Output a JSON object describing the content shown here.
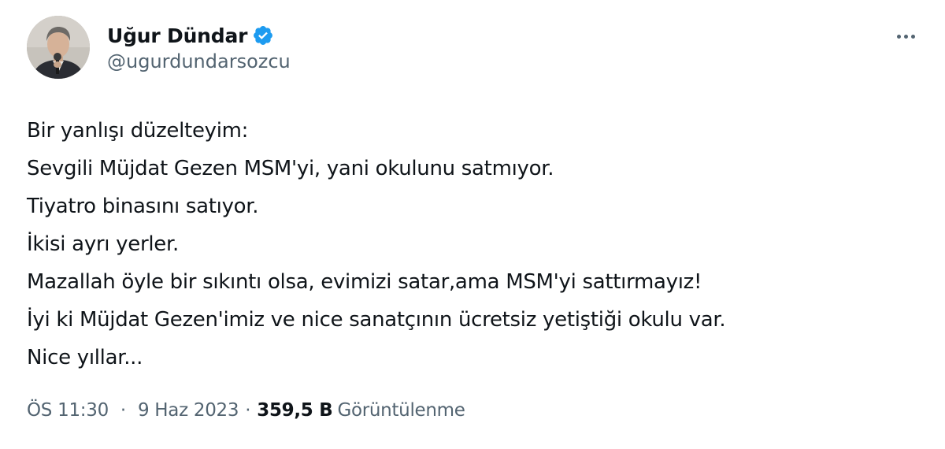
{
  "author": {
    "display_name": "Uğur Dündar",
    "handle": "@ugurdundarsozcu",
    "verified_color": "#1d9bf0"
  },
  "tweet": {
    "lines": [
      "Bir yanlışı düzelteyim:",
      "Sevgili Müjdat Gezen MSM'yi, yani okulunu satmıyor.",
      "Tiyatro binasını satıyor.",
      "İkisi ayrı yerler.",
      "Mazallah öyle bir sıkıntı olsa, evimizi satar,ama MSM'yi sattırmayız!",
      "İyi ki Müjdat Gezen'imiz ve nice sanatçının ücretsiz yetiştiği okulu var.",
      "Nice yıllar..."
    ]
  },
  "meta": {
    "time": "ÖS 11:30",
    "separator": "·",
    "date": "9 Haz 2023",
    "views_count": "359,5 B",
    "views_label": "Görüntülenme"
  },
  "icons": {
    "more": "more-horizontal-icon",
    "verified": "verified-badge-icon"
  }
}
